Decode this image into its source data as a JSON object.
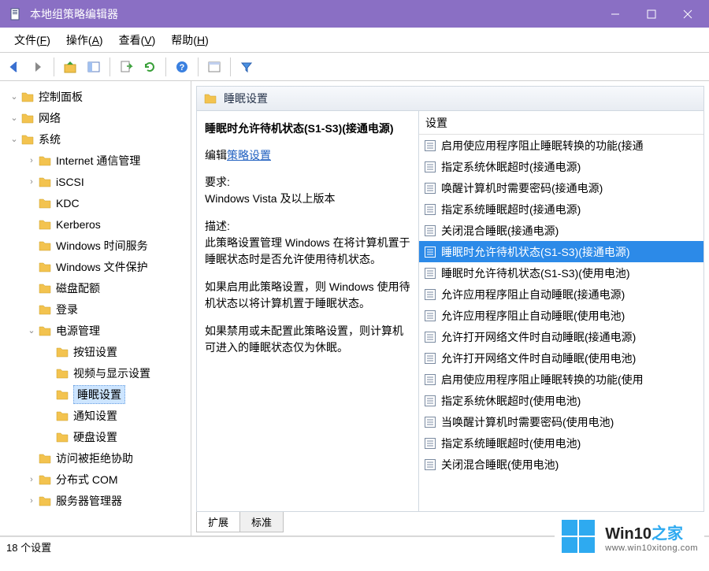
{
  "window": {
    "title": "本地组策略编辑器"
  },
  "menu": {
    "file": "文件",
    "file_u": "F",
    "action": "操作",
    "action_u": "A",
    "view": "查看",
    "view_u": "V",
    "help": "帮助",
    "help_u": "H"
  },
  "toolbar_icons": [
    "back",
    "forward",
    "up",
    "show-hide",
    "export",
    "refresh",
    "help",
    "properties",
    "filter"
  ],
  "tree": [
    {
      "indent": 0,
      "toggle": "open",
      "label": "控制面板"
    },
    {
      "indent": 0,
      "toggle": "open",
      "label": "网络"
    },
    {
      "indent": 0,
      "toggle": "open",
      "label": "系统",
      "expanded": true
    },
    {
      "indent": 1,
      "toggle": "closed",
      "label": "Internet 通信管理"
    },
    {
      "indent": 1,
      "toggle": "closed",
      "label": "iSCSI"
    },
    {
      "indent": 1,
      "toggle": "none",
      "label": "KDC"
    },
    {
      "indent": 1,
      "toggle": "none",
      "label": "Kerberos"
    },
    {
      "indent": 1,
      "toggle": "none",
      "label": "Windows 时间服务"
    },
    {
      "indent": 1,
      "toggle": "none",
      "label": "Windows 文件保护"
    },
    {
      "indent": 1,
      "toggle": "none",
      "label": "磁盘配额"
    },
    {
      "indent": 1,
      "toggle": "none",
      "label": "登录"
    },
    {
      "indent": 1,
      "toggle": "open",
      "label": "电源管理",
      "expanded": true
    },
    {
      "indent": 2,
      "toggle": "none",
      "label": "按钮设置"
    },
    {
      "indent": 2,
      "toggle": "none",
      "label": "视频与显示设置"
    },
    {
      "indent": 2,
      "toggle": "none",
      "label": "睡眠设置",
      "selected": true
    },
    {
      "indent": 2,
      "toggle": "none",
      "label": "通知设置"
    },
    {
      "indent": 2,
      "toggle": "none",
      "label": "硬盘设置"
    },
    {
      "indent": 1,
      "toggle": "none",
      "label": "访问被拒绝协助"
    },
    {
      "indent": 1,
      "toggle": "closed",
      "label": "分布式 COM"
    },
    {
      "indent": 1,
      "toggle": "closed",
      "label": "服务器管理器"
    }
  ],
  "header": {
    "title": "睡眠设置"
  },
  "desc": {
    "title": "睡眠时允许待机状态(S1-S3)(接通电源)",
    "edit_prefix": "编辑",
    "edit_link": "策略设置",
    "req_label": "要求:",
    "req_value": "Windows Vista 及以上版本",
    "desc_label": "描述:",
    "p1": "此策略设置管理 Windows 在将计算机置于睡眠状态时是否允许使用待机状态。",
    "p2": "如果启用此策略设置，则 Windows 使用待机状态以将计算机置于睡眠状态。",
    "p3": "如果禁用或未配置此策略设置，则计算机可进入的睡眠状态仅为休眠。"
  },
  "list": {
    "column": "设置",
    "items": [
      "启用使应用程序阻止睡眠转换的功能(接通",
      "指定系统休眠超时(接通电源)",
      "唤醒计算机时需要密码(接通电源)",
      "指定系统睡眠超时(接通电源)",
      "关闭混合睡眠(接通电源)",
      "睡眠时允许待机状态(S1-S3)(接通电源)",
      "睡眠时允许待机状态(S1-S3)(使用电池)",
      "允许应用程序阻止自动睡眠(接通电源)",
      "允许应用程序阻止自动睡眠(使用电池)",
      "允许打开网络文件时自动睡眠(接通电源)",
      "允许打开网络文件时自动睡眠(使用电池)",
      "启用使应用程序阻止睡眠转换的功能(使用",
      "指定系统休眠超时(使用电池)",
      "当唤醒计算机时需要密码(使用电池)",
      "指定系统睡眠超时(使用电池)",
      "关闭混合睡眠(使用电池)"
    ],
    "selected_index": 5
  },
  "tabs": {
    "extended": "扩展",
    "standard": "标准"
  },
  "status": "18 个设置",
  "watermark": {
    "brand_a": "Win10",
    "brand_b": "之家",
    "url": "www.win10xitong.com"
  }
}
